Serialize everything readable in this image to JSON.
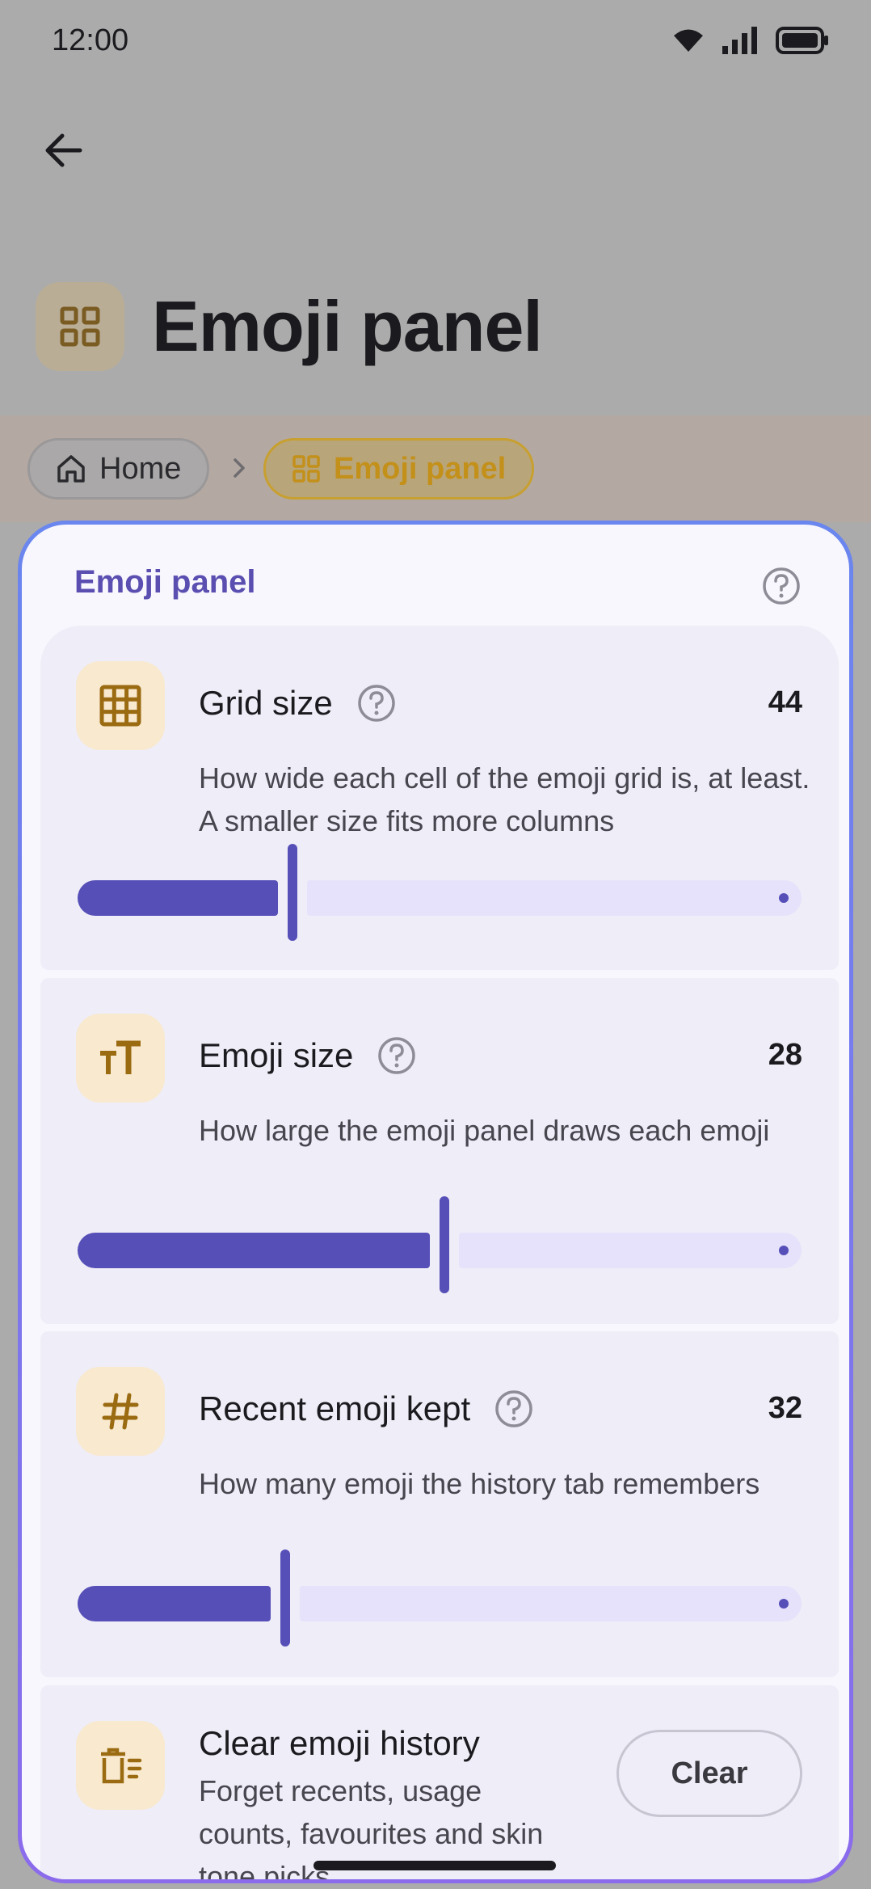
{
  "status_bar": {
    "time": "12:00"
  },
  "header": {
    "title": "Emoji panel"
  },
  "breadcrumb": {
    "home": "Home",
    "current": "Emoji panel"
  },
  "sheet": {
    "title": "Emoji panel",
    "settings": [
      {
        "title": "Grid size",
        "value": "44",
        "description": "How wide each cell of the emoji grid is, at least. A smaller size fits more columns",
        "level": 0.29,
        "icon": "grid-icon"
      },
      {
        "title": "Emoji size",
        "value": "28",
        "description": "How large the emoji panel draws each emoji",
        "level": 0.5,
        "icon": "text-size-icon"
      },
      {
        "title": "Recent emoji kept",
        "value": "32",
        "description": "How many emoji the history tab remembers",
        "level": 0.28,
        "icon": "hash-icon"
      }
    ],
    "clear": {
      "title": "Clear emoji history",
      "description": "Forget recents, usage counts, favourites and skin tone picks",
      "button": "Clear",
      "icon": "clear-list-icon"
    }
  },
  "colors": {
    "accent": "#564fb8",
    "icon_bg": "#f8e9cf",
    "icon_fg": "#9b6b12",
    "sheet_border": "#7b7aee"
  }
}
